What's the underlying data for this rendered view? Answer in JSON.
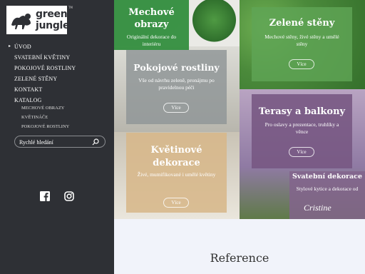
{
  "brand": {
    "line1": "green",
    "line2": "jungle",
    "tm": "TM"
  },
  "menu": {
    "items": [
      {
        "label": "ÚVOD"
      },
      {
        "label": "SVATEBNÍ KVĚTINY"
      },
      {
        "label": "POKOJOVÉ ROSTLINY"
      },
      {
        "label": "ZELENÉ STĚNY"
      },
      {
        "label": "KONTAKT"
      },
      {
        "label": "KATALOG"
      }
    ],
    "submenu": [
      {
        "label": "MECHOVÉ OBRAZY"
      },
      {
        "label": "KVĚTINÁČE"
      },
      {
        "label": "POKOJOVÉ ROSTLINY"
      }
    ]
  },
  "search": {
    "placeholder": "Rychlé hledání"
  },
  "social": {
    "facebook": "facebook-icon",
    "instagram": "instagram-icon"
  },
  "tiles": {
    "mechove": {
      "title": "Mechové obrazy",
      "desc": "Originální dekorace do interiéru"
    },
    "zelene": {
      "title": "Zelené stěny",
      "desc": "Mechové stěny, živé stěny a umělé stěny",
      "button": "Více"
    },
    "pokojove": {
      "title": "Pokojové rostliny",
      "desc": "Vše od návrhu zeleně, pronájmu po pravidelnou péči",
      "button": "Více"
    },
    "terasy": {
      "title": "Terasy a balkony",
      "desc": "Pro oslavy a prezentace, truhlíky a věnce",
      "button": "Více"
    },
    "kvetinove": {
      "title": "Květinové dekorace",
      "desc": "Živé, mumifikované i umělé květiny",
      "button": "Více"
    },
    "svatebni": {
      "title": "Svatební dekorace",
      "desc": "Stylové kytice a dekorace od",
      "script": "Cristine"
    }
  },
  "reference": {
    "title": "Reference"
  },
  "colors": {
    "sidebar": "#2e3035",
    "green": "#3a8f3c",
    "beige": "#d7b78a",
    "purple": "#7e5d86",
    "lavender": "#f1f3fa"
  }
}
